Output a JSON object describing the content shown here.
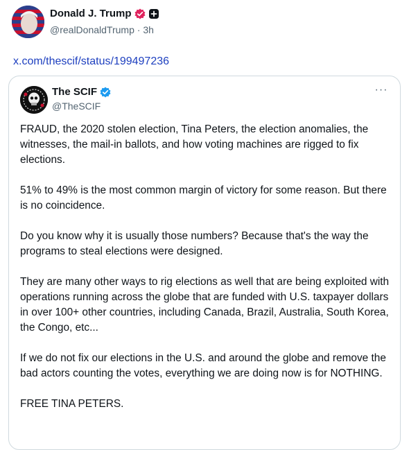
{
  "post": {
    "author": {
      "display_name": "Donald J. Trump",
      "handle": "@realDonaldTrump",
      "separator": "·",
      "time": "3h",
      "badges": [
        "verified-pink-icon",
        "square-plus-icon"
      ]
    },
    "link_text": "x.com/thescif/status/199497236"
  },
  "quote": {
    "display_name": "The SCIF",
    "handle": "@TheSCIF",
    "more_label": "···",
    "paragraphs": [
      "FRAUD, the 2020 stolen election, Tina Peters, the election anomalies, the witnesses, the mail-in ballots, and how voting machines are rigged to fix elections.",
      "51% to 49% is the most common margin of victory for some reason. But there is no coincidence.",
      "Do you know why it is usually those numbers? Because that's the way the programs to steal elections were designed.",
      "They are many other ways to rig elections as well that are being exploited with operations running across the globe that are funded with U.S. taxpayer dollars in over 100+ other countries, including Canada, Brazil, Australia, South Korea, the Congo, etc...",
      "If we do not fix our elections in the U.S. and around the globe and remove the bad actors counting the votes, everything we are doing now is for NOTHING.",
      "FREE TINA PETERS."
    ]
  },
  "colors": {
    "link": "#1d3fbf",
    "muted": "#536471",
    "verified_pink": "#e0245e",
    "verified_blue": "#1d9bf0"
  }
}
